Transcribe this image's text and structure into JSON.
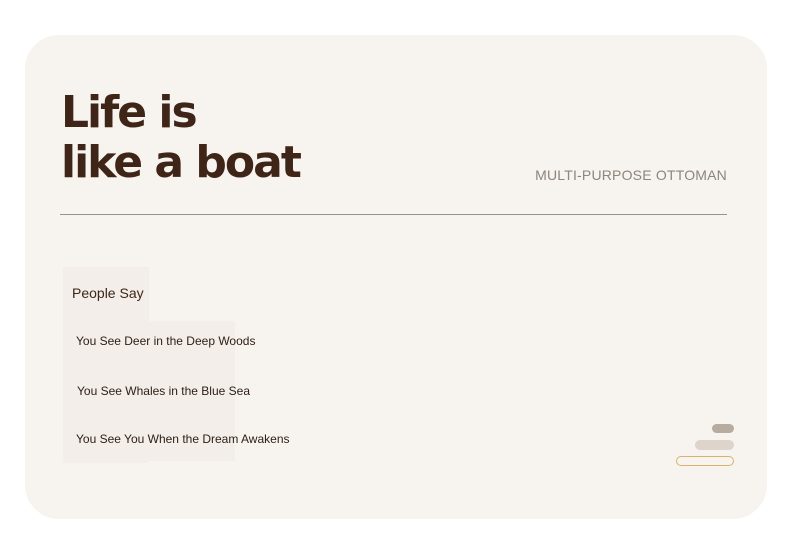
{
  "headline": {
    "line1": "Life is",
    "line2": "like a boat"
  },
  "subtitle": "MULTI-PURPOSE OTTOMAN",
  "section_title": "People Say",
  "quotes": [
    "You See Deer in the Deep Woods",
    "You See Whales in the Blue Sea",
    "You See You When the Dream Awakens"
  ],
  "colors": {
    "card_background": "#f7f3ef",
    "headline": "#3e2518",
    "accent_outline": "#d9b36c",
    "pager_active": "#b8aca0",
    "pager_muted": "#ddd4cb"
  },
  "pager": {
    "count": 3
  }
}
